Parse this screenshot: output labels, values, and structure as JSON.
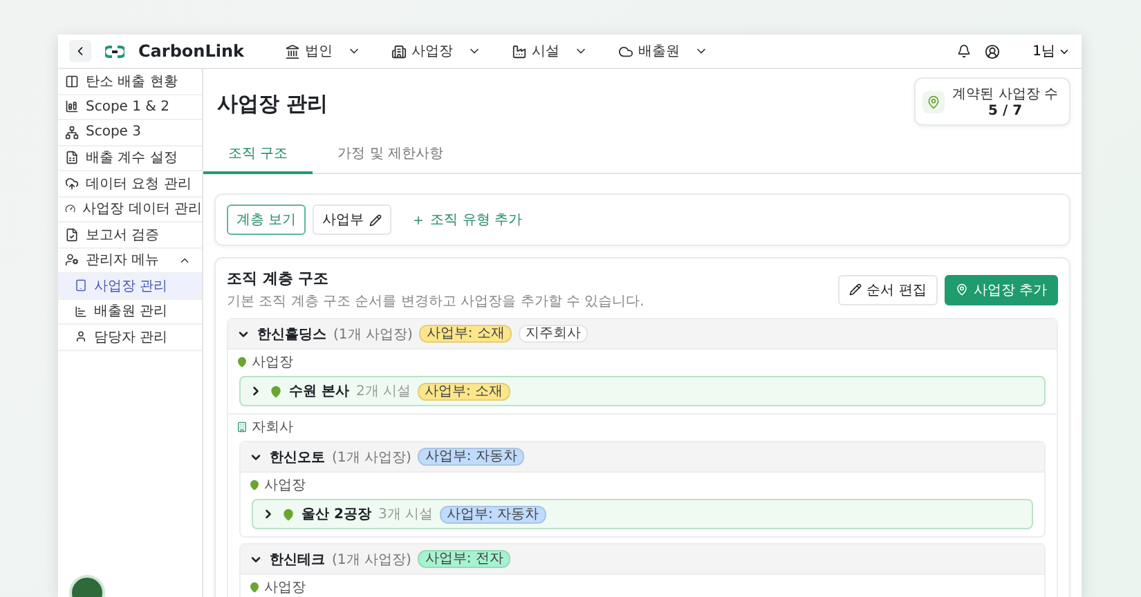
{
  "header": {
    "logo": "CarbonLink",
    "nav": [
      {
        "label": "법인"
      },
      {
        "label": "사업장"
      },
      {
        "label": "시설"
      },
      {
        "label": "배출원"
      }
    ],
    "user": "1님"
  },
  "sidebar": {
    "items": [
      {
        "label": "탄소 배출 현황",
        "selected": false
      },
      {
        "label": "Scope 1 & 2",
        "selected": false
      },
      {
        "label": "Scope 3",
        "selected": false
      },
      {
        "label": "배출 계수 설정",
        "selected": false
      },
      {
        "label": "데이터 요청 관리",
        "selected": false
      },
      {
        "label": "사업장 데이터 관리",
        "selected": false
      },
      {
        "label": "보고서 검증",
        "selected": false
      },
      {
        "label": "관리자 메뉴",
        "selected": false,
        "expanded": true,
        "children": [
          {
            "label": "사업장 관리",
            "selected": true
          },
          {
            "label": "배출원 관리",
            "selected": false
          },
          {
            "label": "담당자 관리",
            "selected": false
          }
        ]
      }
    ]
  },
  "page": {
    "title": "사업장 관리",
    "stat": {
      "label": "계약된 사업장 수",
      "value": "5 / 7"
    }
  },
  "tabs": [
    {
      "label": "조직 구조",
      "selected": true
    },
    {
      "label": "가정 및 제한사항",
      "selected": false
    }
  ],
  "toolbar": {
    "views": [
      {
        "label": "계층 보기",
        "selected": true,
        "kind": "view"
      },
      {
        "label": "사업부",
        "selected": false,
        "kind": "editable"
      }
    ],
    "add": "조직 유형 추가"
  },
  "organization": {
    "title": "조직 계층 구조",
    "description": "기본 조직 계층 구조 순서를 변경하고 사업장을 추가할 수 있습니다.",
    "buttons": [
      {
        "label": "순서 편집",
        "kind": "secondary"
      },
      {
        "label": "사업장 추가",
        "kind": "primary"
      }
    ],
    "groups": [
      {
        "name": "한신홀딩스",
        "count": "(1개 사업장)",
        "expanded": true,
        "badges": [
          {
            "label": "사업부: 소재",
            "color": "#fde68a"
          },
          {
            "label": "지주회사",
            "color": "#ffffff"
          }
        ],
        "sections": [
          {
            "kind": "sites",
            "label": "사업장",
            "sites": [
              {
                "name": "수원 본사",
                "facilities": "2개 시설",
                "expanded": false,
                "badge": {
                  "label": "사업부: 소재",
                  "color": "#fde68a"
                }
              }
            ]
          },
          {
            "kind": "subsidiaries",
            "label": "자회사",
            "groups": [
              {
                "name": "한신오토",
                "count": "(1개 사업장)",
                "expanded": true,
                "badges": [
                  {
                    "label": "사업부: 자동차",
                    "color": "#bfdbfe"
                  }
                ],
                "sections": [
                  {
                    "kind": "sites",
                    "label": "사업장",
                    "sites": [
                      {
                        "name": "울산 2공장",
                        "facilities": "3개 시설",
                        "expanded": false,
                        "badge": {
                          "label": "사업부: 자동차",
                          "color": "#bfdbfe"
                        }
                      }
                    ]
                  }
                ]
              },
              {
                "name": "한신테크",
                "count": "(1개 사업장)",
                "expanded": true,
                "badges": [
                  {
                    "label": "사업부: 전자",
                    "color": "#a7f3d0"
                  }
                ],
                "sections": [
                  {
                    "kind": "sites",
                    "label": "사업장"
                  }
                ]
              }
            ]
          }
        ]
      }
    ]
  }
}
